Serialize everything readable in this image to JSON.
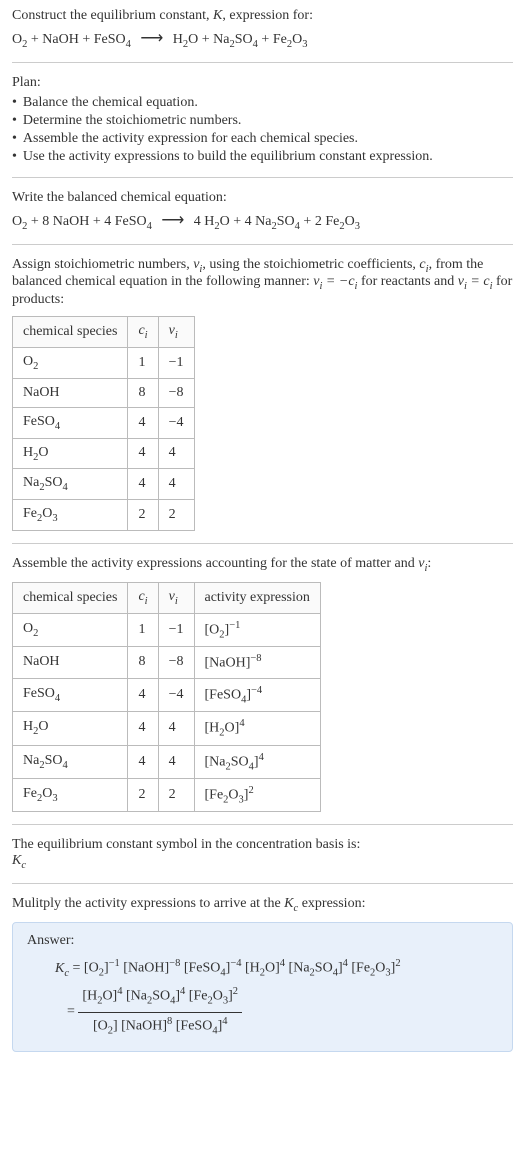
{
  "intro": {
    "line1_a": "Construct the equilibrium constant, ",
    "line1_b": ", expression for:",
    "eq_lhs": "O₂ + NaOH + FeSO₄",
    "arrow": "⟶",
    "eq_rhs": "H₂O + Na₂SO₄ + Fe₂O₃"
  },
  "plan": {
    "heading": "Plan:",
    "items": [
      "Balance the chemical equation.",
      "Determine the stoichiometric numbers.",
      "Assemble the activity expression for each chemical species.",
      "Use the activity expressions to build the equilibrium constant expression."
    ]
  },
  "balanced": {
    "heading": "Write the balanced chemical equation:",
    "eq_lhs": "O₂ + 8 NaOH + 4 FeSO₄",
    "arrow": "⟶",
    "eq_rhs": "4 H₂O + 4 Na₂SO₄ + 2 Fe₂O₃"
  },
  "assign": {
    "text_a": "Assign stoichiometric numbers, ",
    "text_b": ", using the stoichiometric coefficients, ",
    "text_c": ", from the balanced chemical equation in the following manner: ",
    "text_d": " for reactants and ",
    "text_e": " for products:"
  },
  "symbols": {
    "K": "K",
    "nu_i": "νᵢ",
    "c_i": "cᵢ",
    "nu_eq_neg_c": "νᵢ = −cᵢ",
    "nu_eq_c": "νᵢ = cᵢ",
    "Kc": "K_c"
  },
  "table1": {
    "headers": [
      "chemical species",
      "cᵢ",
      "νᵢ"
    ],
    "rows": [
      {
        "sp": "O₂",
        "c": "1",
        "nu": "−1"
      },
      {
        "sp": "NaOH",
        "c": "8",
        "nu": "−8"
      },
      {
        "sp": "FeSO₄",
        "c": "4",
        "nu": "−4"
      },
      {
        "sp": "H₂O",
        "c": "4",
        "nu": "4"
      },
      {
        "sp": "Na₂SO₄",
        "c": "4",
        "nu": "4"
      },
      {
        "sp": "Fe₂O₃",
        "c": "2",
        "nu": "2"
      }
    ]
  },
  "assemble": {
    "text_a": "Assemble the activity expressions accounting for the state of matter and ",
    "text_b": ":"
  },
  "table2": {
    "headers": [
      "chemical species",
      "cᵢ",
      "νᵢ",
      "activity expression"
    ],
    "rows": [
      {
        "sp": "O₂",
        "c": "1",
        "nu": "−1",
        "act": "[O₂]⁻¹"
      },
      {
        "sp": "NaOH",
        "c": "8",
        "nu": "−8",
        "act": "[NaOH]⁻⁸"
      },
      {
        "sp": "FeSO₄",
        "c": "4",
        "nu": "−4",
        "act": "[FeSO₄]⁻⁴"
      },
      {
        "sp": "H₂O",
        "c": "4",
        "nu": "4",
        "act": "[H₂O]⁴"
      },
      {
        "sp": "Na₂SO₄",
        "c": "4",
        "nu": "4",
        "act": "[Na₂SO₄]⁴"
      },
      {
        "sp": "Fe₂O₃",
        "c": "2",
        "nu": "2",
        "act": "[Fe₂O₃]²"
      }
    ]
  },
  "kc_symbol": {
    "line1": "The equilibrium constant symbol in the concentration basis is:",
    "line2_html": "K"
  },
  "multiply": {
    "text_a": "Mulitply the activity expressions to arrive at the ",
    "text_b": " expression:"
  },
  "answer": {
    "label": "Answer:",
    "line1": "K_c = [O₂]⁻¹ [NaOH]⁻⁸ [FeSO₄]⁻⁴ [H₂O]⁴ [Na₂SO₄]⁴ [Fe₂O₃]²",
    "frac_num": "[H₂O]⁴ [Na₂SO₄]⁴ [Fe₂O₃]²",
    "frac_den": "[O₂] [NaOH]⁸ [FeSO₄]⁴"
  }
}
